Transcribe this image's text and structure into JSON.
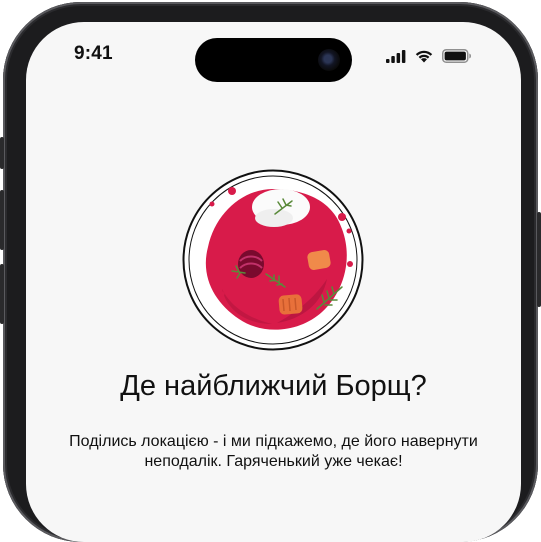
{
  "status_bar": {
    "time": "9:41",
    "icons": [
      "cellular-signal-icon",
      "wifi-icon",
      "battery-icon"
    ]
  },
  "illustration": {
    "name": "borscht-bowl-illustration",
    "accent_color": "#d81b4a"
  },
  "content": {
    "title": "Де найближчий Борщ?",
    "subtitle": "Поділись локацією - і ми підкажемо, де його навернути неподалік. Гаряченький уже чекає!"
  }
}
